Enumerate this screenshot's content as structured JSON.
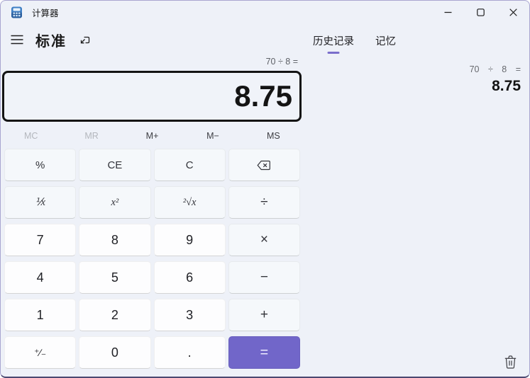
{
  "titlebar": {
    "title": "计算器"
  },
  "header": {
    "mode_label": "标准"
  },
  "tabs": {
    "history_label": "历史记录",
    "memory_label": "记忆",
    "active": "history"
  },
  "display": {
    "expression": "70 ÷ 8 =",
    "value": "8.75"
  },
  "memory": {
    "mc": "MC",
    "mr": "MR",
    "m_plus": "M+",
    "m_minus": "M−",
    "ms": "MS",
    "disabled": [
      "MC",
      "MR"
    ]
  },
  "keypad": {
    "percent": "%",
    "ce": "CE",
    "c": "C",
    "backspace": "⌫",
    "reciprocal": "⅟x",
    "square": "x²",
    "sqrt": "²√x",
    "divide": "÷",
    "seven": "7",
    "eight": "8",
    "nine": "9",
    "multiply": "×",
    "four": "4",
    "five": "5",
    "six": "6",
    "minus": "−",
    "one": "1",
    "two": "2",
    "three": "3",
    "plus": "+",
    "negate": "⁺∕₋",
    "zero": "0",
    "decimal": ".",
    "equals": "="
  },
  "history": {
    "entry_expression": "70 ÷ 8 =",
    "entry_result": "8.75"
  },
  "icons": {
    "app": "calculator-icon",
    "menu": "hamburger-icon",
    "keep_on_top": "keep-on-top-icon",
    "minimize": "minimize-icon",
    "maximize": "maximize-icon",
    "close": "close-icon",
    "backspace": "backspace-icon",
    "trash": "trash-icon"
  },
  "colors": {
    "accent": "#7166c9",
    "tab_underline": "#7a6ecb",
    "window_bg": "#eef1f8"
  }
}
